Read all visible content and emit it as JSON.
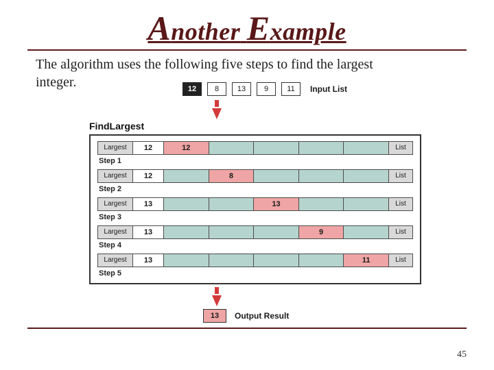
{
  "title": {
    "w1_cap": "A",
    "w1_rest": "nother",
    "sp": " ",
    "w2_cap": "E",
    "w2_rest": "xample"
  },
  "body_line1": "The algorithm uses the following five steps to find the largest",
  "body_line2": "integer.",
  "input": {
    "values": [
      "12",
      "8",
      "13",
      "9",
      "11"
    ],
    "highlight_index": 0,
    "label": "Input List"
  },
  "proc_title": "FindLargest",
  "labels": {
    "left": "Largest",
    "right": "List"
  },
  "steps": [
    {
      "name": "Step 1",
      "largest": "12",
      "active_index": 0,
      "active_value": "12"
    },
    {
      "name": "Step 2",
      "largest": "12",
      "active_index": 1,
      "active_value": "8"
    },
    {
      "name": "Step 3",
      "largest": "13",
      "active_index": 2,
      "active_value": "13"
    },
    {
      "name": "Step 4",
      "largest": "13",
      "active_index": 3,
      "active_value": "9"
    },
    {
      "name": "Step 5",
      "largest": "13",
      "active_index": 4,
      "active_value": "11"
    }
  ],
  "output": {
    "value": "13",
    "label": "Output Result"
  },
  "page_number": "45"
}
